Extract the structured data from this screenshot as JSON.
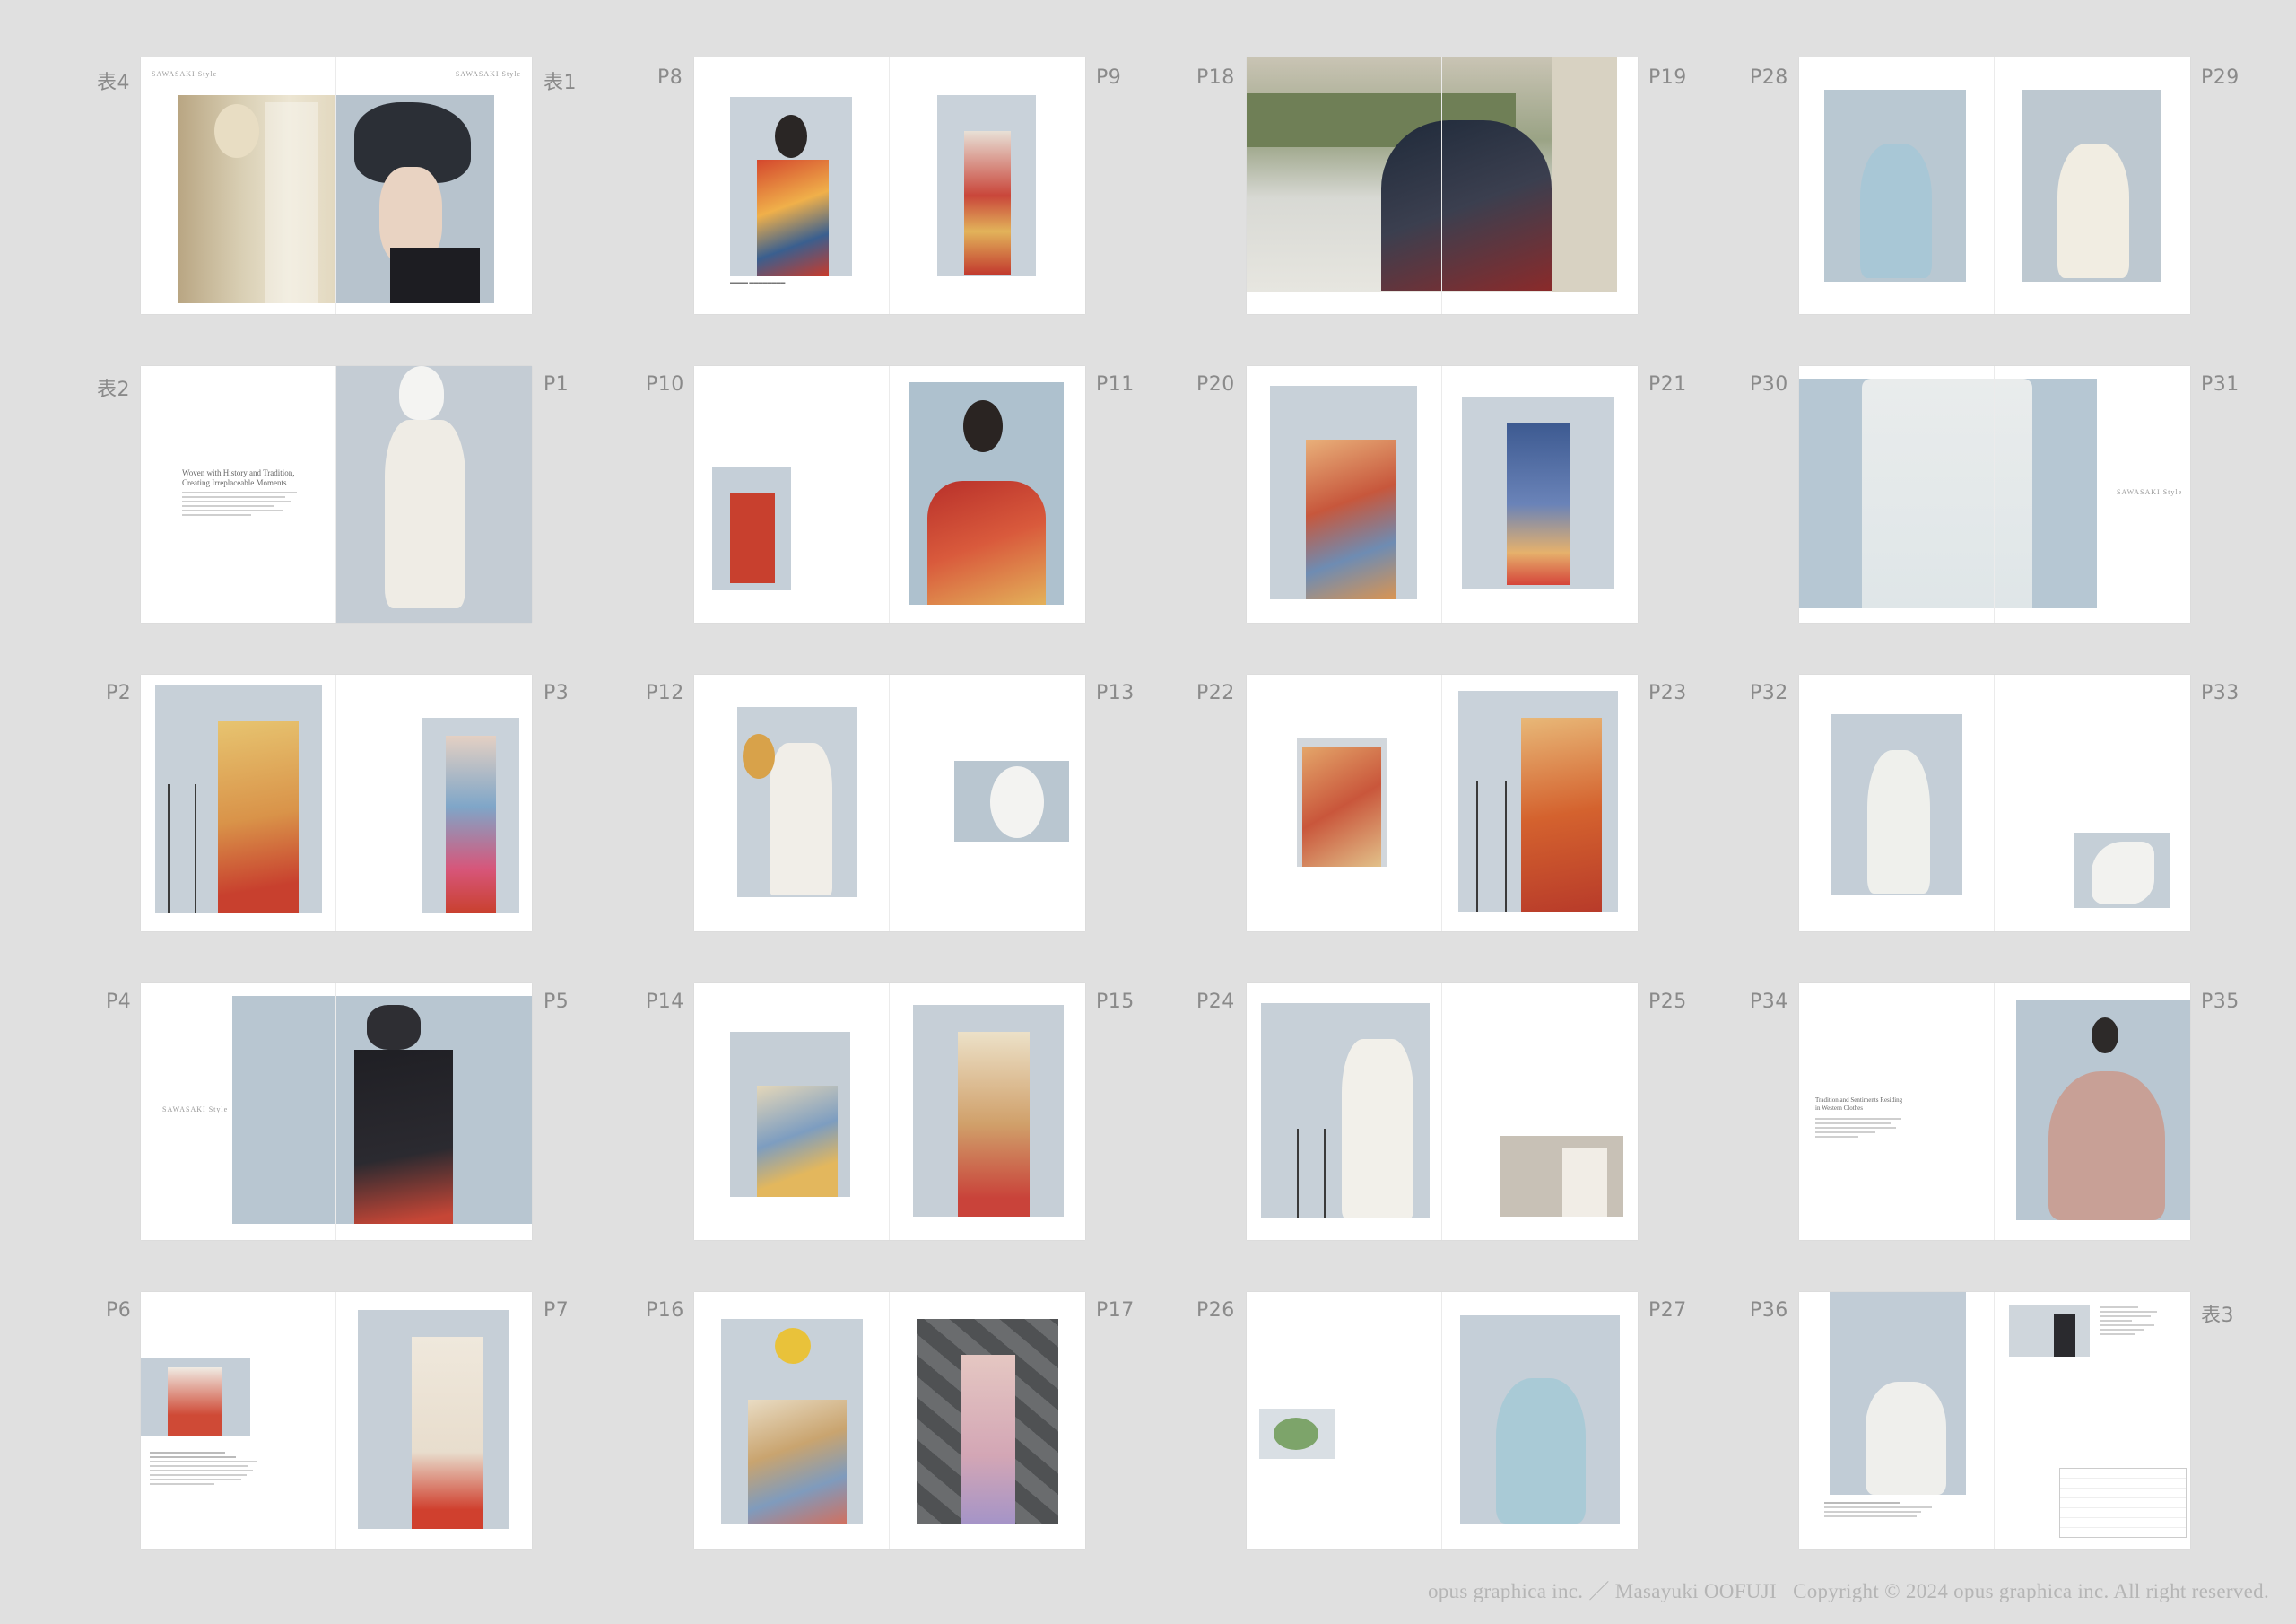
{
  "footer": {
    "credit": "opus graphica inc. ／ Masayuki OOFUJI",
    "copyright": "Copyright © 2024 opus graphica inc. All right reserved."
  },
  "spreads": [
    {
      "left": "表4",
      "right": "表1",
      "tag_left": "SAWASAKI Style",
      "tag_right": "SAWASAKI Style"
    },
    {
      "left": "P8",
      "right": "P9"
    },
    {
      "left": "P18",
      "right": "P19"
    },
    {
      "left": "P28",
      "right": "P29"
    },
    {
      "left": "表2",
      "right": "P1",
      "heading": [
        "Woven with History and Tradition,",
        "Creating Irreplaceable Moments"
      ]
    },
    {
      "left": "P10",
      "right": "P11"
    },
    {
      "left": "P20",
      "right": "P21"
    },
    {
      "left": "P30",
      "right": "P31",
      "tag_right": "SAWASAKI Style"
    },
    {
      "left": "P2",
      "right": "P3"
    },
    {
      "left": "P12",
      "right": "P13"
    },
    {
      "left": "P22",
      "right": "P23"
    },
    {
      "left": "P32",
      "right": "P33"
    },
    {
      "left": "P4",
      "right": "P5",
      "tag_left": "SAWASAKI Style"
    },
    {
      "left": "P14",
      "right": "P15"
    },
    {
      "left": "P24",
      "right": "P25"
    },
    {
      "left": "P34",
      "right": "P35",
      "heading": [
        "Tradition and Sentiments Residing",
        "in Western Clothes"
      ]
    },
    {
      "left": "P6",
      "right": "P7"
    },
    {
      "left": "P16",
      "right": "P17"
    },
    {
      "left": "P26",
      "right": "P27"
    },
    {
      "left": "P36",
      "right": "表3"
    }
  ],
  "colors": {
    "background": "#e0e0e0",
    "page": "#ffffff",
    "label": "#8a8a8a",
    "footer": "#b5b5b5",
    "studio_backdrop": "#c3cdd6"
  }
}
